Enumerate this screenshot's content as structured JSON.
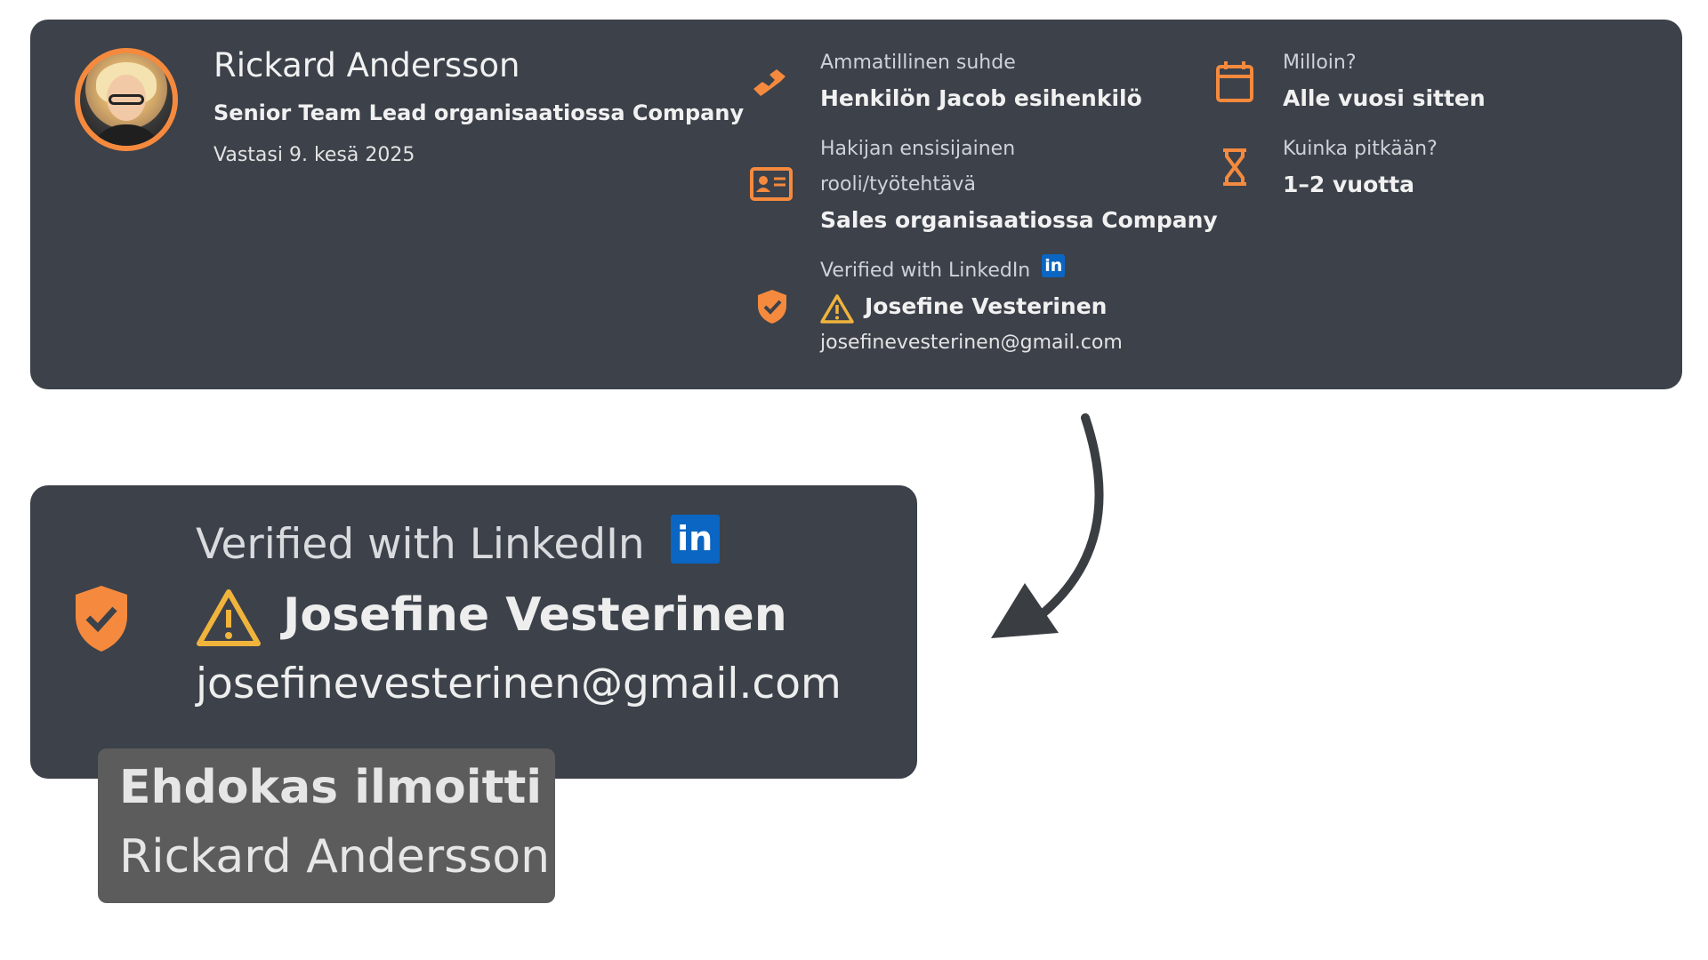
{
  "reference": {
    "name": "Rickard Andersson",
    "title": "Senior Team Lead organisaatiossa Company",
    "answered": "Vastasi 9. kesä 2025",
    "relation": {
      "label": "Ammatillinen suhde",
      "value": "Henkilön Jacob esihenkilö",
      "icon": "handshake-icon"
    },
    "when": {
      "label": "Milloin?",
      "value": "Alle vuosi sitten",
      "icon": "calendar-icon"
    },
    "role": {
      "label_line1": "Hakijan ensisijainen",
      "label_line2": "rooli/työtehtävä",
      "value": "Sales organisaatiossa Company",
      "icon": "id-card-icon"
    },
    "duration": {
      "label": "Kuinka pitkään?",
      "value": "1–2 vuotta",
      "icon": "hourglass-icon"
    },
    "verification": {
      "label": "Verified with LinkedIn",
      "linkedin_badge": "in",
      "verified_name": "Josefine Vesterinen",
      "verified_email": "josefinevesterinen@gmail.com",
      "icon": "shield-check-icon",
      "warning_icon": "warning-icon"
    }
  },
  "zoom": {
    "label": "Verified with LinkedIn",
    "linkedin_badge": "in",
    "verified_name": "Josefine Vesterinen",
    "verified_email": "josefinevesterinen@gmail.com"
  },
  "tooltip": {
    "line1": "Ehdokas ilmoitti",
    "line2": "Rickard Andersson"
  },
  "colors": {
    "card_bg": "#3c414a",
    "accent": "#f58a3e",
    "warning": "#f0b43c",
    "linkedin": "#0a66c2",
    "tooltip_bg": "#5c5c5c",
    "arrow": "#3a3d42"
  }
}
